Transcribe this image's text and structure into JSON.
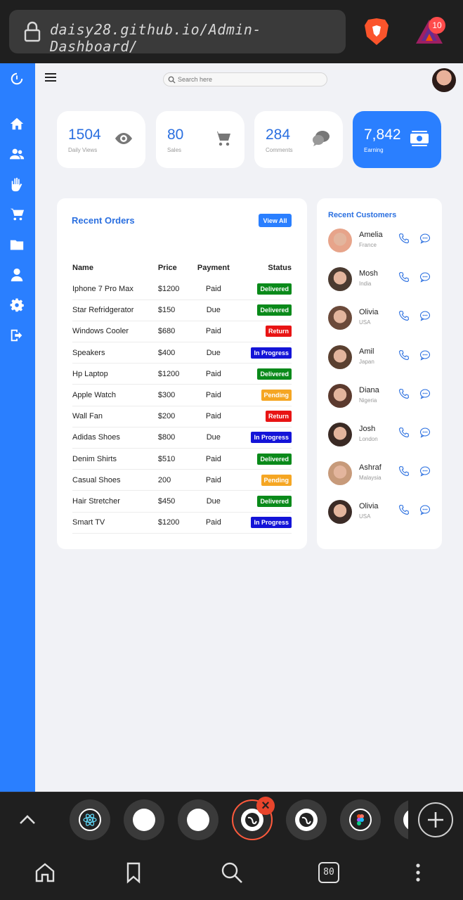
{
  "browser": {
    "url": "daisy28.github.io/Admin-Dashboard/",
    "rewards_badge": "10",
    "tabs_count": "80"
  },
  "header": {
    "search_placeholder": "Search here"
  },
  "sidebar": {
    "items": [
      "dashboard-timer-icon",
      "home-icon",
      "users-icon",
      "hand-icon",
      "cart-icon",
      "folder-icon",
      "user-icon",
      "gear-icon",
      "logout-icon"
    ]
  },
  "stats": [
    {
      "value": "1504",
      "label": "Daily Views",
      "icon": "eye-icon"
    },
    {
      "value": "80",
      "label": "Sales",
      "icon": "cart-icon"
    },
    {
      "value": "284",
      "label": "Comments",
      "icon": "comments-icon"
    },
    {
      "value": "7,842",
      "label": "Earning",
      "icon": "money-icon"
    }
  ],
  "orders": {
    "title": "Recent Orders",
    "view_all": "View All",
    "headers": {
      "name": "Name",
      "price": "Price",
      "payment": "Payment",
      "status": "Status"
    },
    "status_colors": {
      "Delivered": "#0a8a1a",
      "Return": "#e81414",
      "In Progress": "#1414d8",
      "Pending": "#f5a623"
    },
    "rows": [
      {
        "name": "Iphone 7 Pro Max",
        "price": "$1200",
        "payment": "Paid",
        "status": "Delivered"
      },
      {
        "name": "Star Refridgerator",
        "price": "$150",
        "payment": "Due",
        "status": "Delivered"
      },
      {
        "name": "Windows Cooler",
        "price": "$680",
        "payment": "Paid",
        "status": "Return"
      },
      {
        "name": "Speakers",
        "price": "$400",
        "payment": "Due",
        "status": "In Progress"
      },
      {
        "name": "Hp Laptop",
        "price": "$1200",
        "payment": "Paid",
        "status": "Delivered"
      },
      {
        "name": "Apple Watch",
        "price": "$300",
        "payment": "Paid",
        "status": "Pending"
      },
      {
        "name": "Wall Fan",
        "price": "$200",
        "payment": "Paid",
        "status": "Return"
      },
      {
        "name": "Adidas Shoes",
        "price": "$800",
        "payment": "Due",
        "status": "In Progress"
      },
      {
        "name": "Denim Shirts",
        "price": "$510",
        "payment": "Paid",
        "status": "Delivered"
      },
      {
        "name": "Casual Shoes",
        "price": "200",
        "payment": "Paid",
        "status": "Pending"
      },
      {
        "name": "Hair Stretcher",
        "price": "$450",
        "payment": "Due",
        "status": "Delivered"
      },
      {
        "name": "Smart TV",
        "price": "$1200",
        "payment": "Paid",
        "status": "In Progress"
      }
    ]
  },
  "customers": {
    "title": "Recent Customers",
    "list": [
      {
        "name": "Amelia",
        "country": "France"
      },
      {
        "name": "Mosh",
        "country": "India"
      },
      {
        "name": "Olivia",
        "country": "USA"
      },
      {
        "name": "Amil",
        "country": "Japan"
      },
      {
        "name": "Diana",
        "country": "Nigeria"
      },
      {
        "name": "Josh",
        "country": "London"
      },
      {
        "name": "Ashraf",
        "country": "Malaysia"
      },
      {
        "name": "Olivia",
        "country": "USA"
      }
    ]
  },
  "colors": {
    "accent": "#2a7fff",
    "heading_blue": "#2a6fe0"
  }
}
